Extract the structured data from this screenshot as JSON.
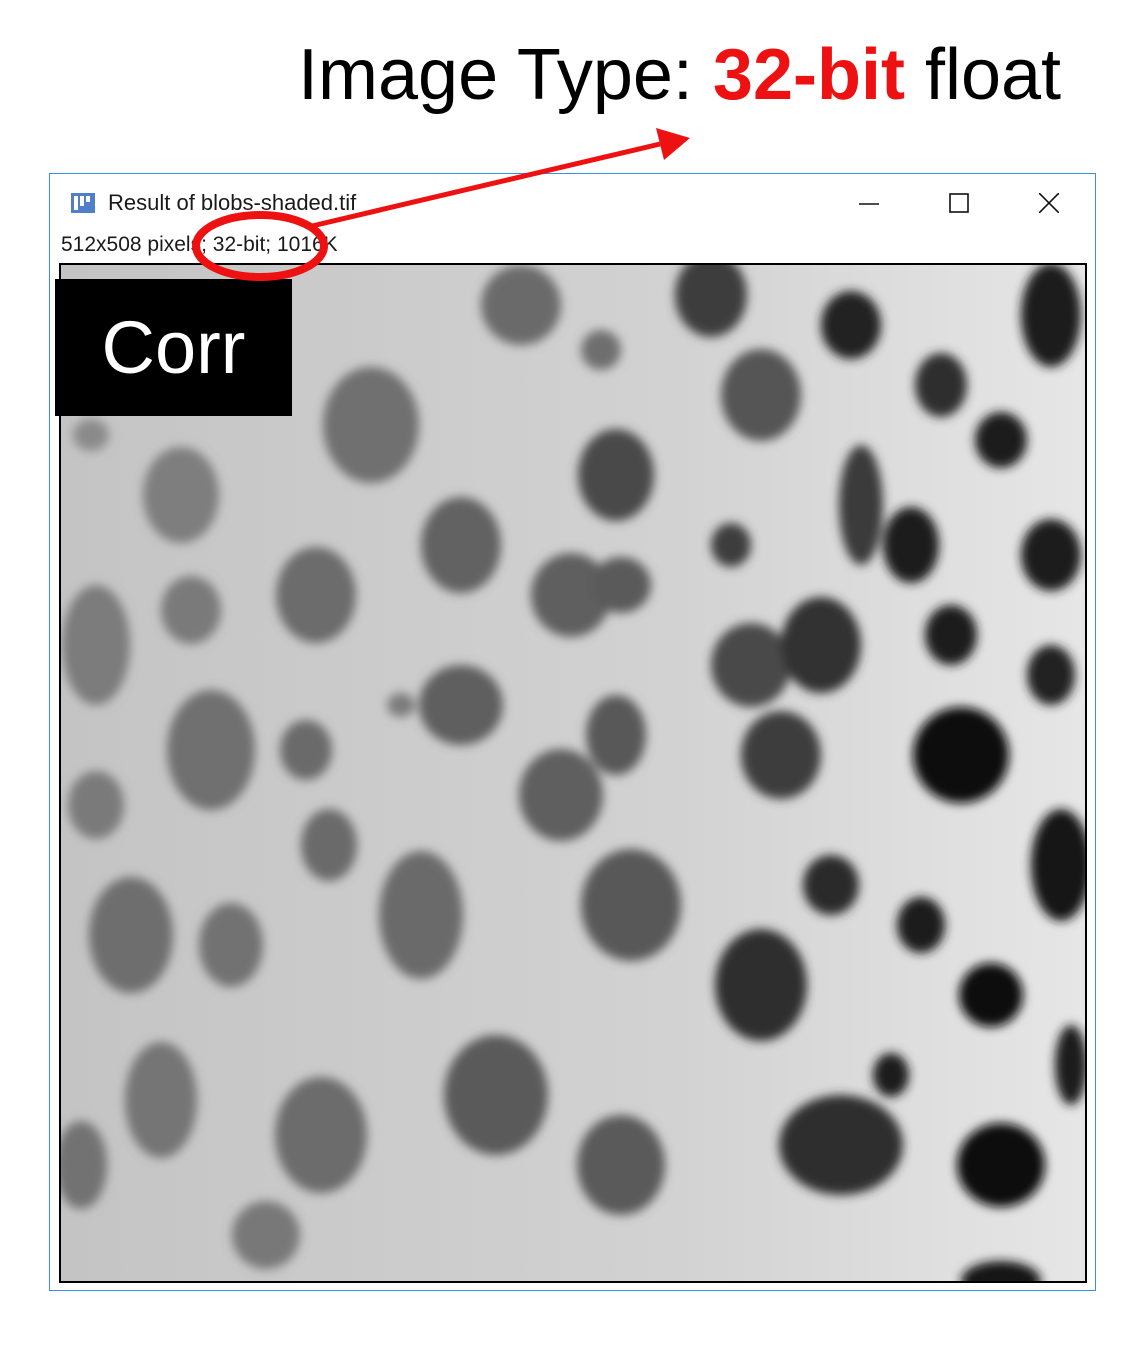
{
  "headline": {
    "prefix": "Image Type: ",
    "accent": "32-bit",
    "suffix": " float",
    "accent_color": "#ee1111"
  },
  "window": {
    "title": "Result of blobs-shaded.tif",
    "status_info": "512x508 pixels; 32-bit; 1016K",
    "icon": "imagej-icon",
    "controls": [
      "minimize-icon",
      "maximize-icon",
      "close-icon"
    ],
    "frame_color": "#3c8ee0"
  },
  "image": {
    "overlay_label": "Corr"
  },
  "annotation": {
    "color": "#ee1111",
    "shapes": [
      "highlight-ellipse",
      "pointer-arrow"
    ]
  }
}
